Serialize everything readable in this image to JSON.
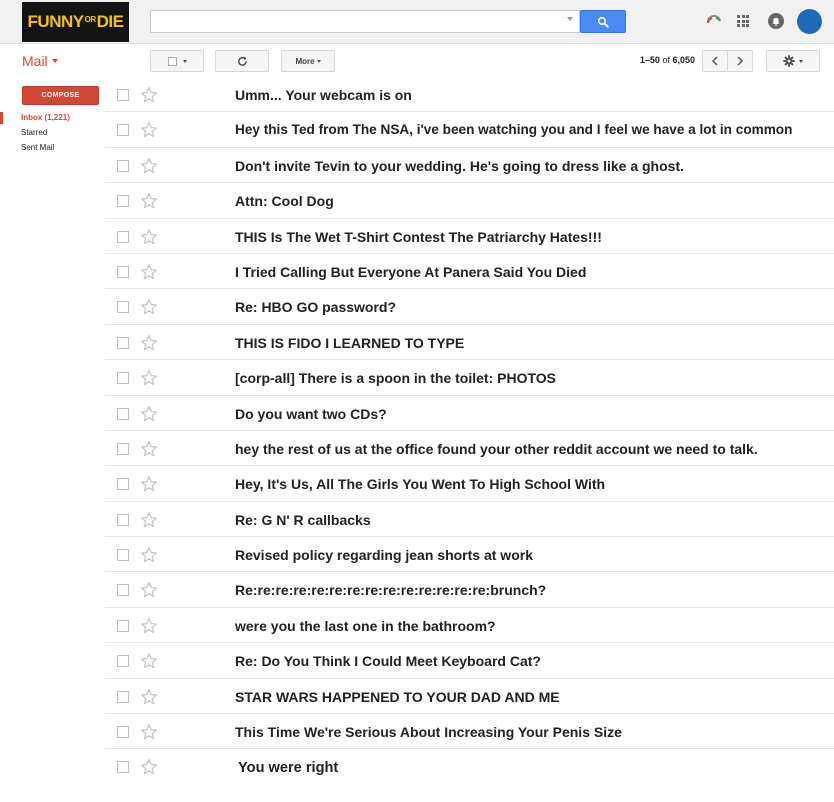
{
  "header": {
    "logo": {
      "part1": "FUNNY",
      "part2": "OR",
      "part3": "DIE"
    },
    "search": {
      "value": "",
      "placeholder": ""
    }
  },
  "app_label": "Mail",
  "toolbar": {
    "more_label": "More",
    "pagination": {
      "range": "1–50",
      "of": "of",
      "total": "6,050"
    }
  },
  "compose_label": "COMPOSE",
  "nav": {
    "items": [
      {
        "label": "Inbox (1,221)",
        "active": true
      },
      {
        "label": "Starred",
        "active": false
      },
      {
        "label": "Sent Mail",
        "active": false
      }
    ]
  },
  "messages": [
    {
      "subject": "Umm... Your webcam is on"
    },
    {
      "subject": "Hey this Ted from The NSA, i've been watching you and I feel we have a lot in common"
    },
    {
      "subject": "Don't invite Tevin to your wedding. He's going to dress like a ghost."
    },
    {
      "subject": "Attn: Cool Dog"
    },
    {
      "subject": "THIS Is The Wet T-Shirt Contest The Patriarchy Hates!!!"
    },
    {
      "subject": "I Tried Calling But Everyone At Panera Said You Died"
    },
    {
      "subject": "Re: HBO GO password?"
    },
    {
      "subject": "THIS IS FIDO I LEARNED TO TYPE"
    },
    {
      "subject": "[corp-all] There is a spoon in the toilet: PHOTOS"
    },
    {
      "subject": "Do you want two CDs?"
    },
    {
      "subject": "hey the rest of us at the office found your other reddit account we need to talk."
    },
    {
      "subject": "Hey, It's Us, All The Girls You Went To High School With"
    },
    {
      "subject": "Re: G N' R callbacks"
    },
    {
      "subject": "Revised policy regarding jean shorts at work"
    },
    {
      "subject": "Re:re:re:re:re:re:re:re:re:re:re:re:re:re:brunch?"
    },
    {
      "subject": "were you the last one in the bathroom?"
    },
    {
      "subject": "Re: Do You Think I Could Meet Keyboard Cat?"
    },
    {
      "subject": "STAR WARS HAPPENED TO YOUR DAD AND ME"
    },
    {
      "subject": "This Time We're Serious About Increasing Your Penis Size"
    },
    {
      "subject": "You were right"
    }
  ],
  "colors": {
    "accent": "#d14836",
    "search_button": "#4a8af4",
    "avatar": "#1d6ab8",
    "logo_bg": "#141414",
    "logo_text": "#f5c10f"
  },
  "icons": {
    "search_button": "search-icon",
    "refresh": "refresh-icon",
    "prev": "chevron-left-icon",
    "next": "chevron-right-icon",
    "settings": "gear-icon",
    "apps": "apps-grid-icon",
    "notifications": "notifications-icon",
    "loading": "loading-arc-icon",
    "star": "star-icon"
  }
}
